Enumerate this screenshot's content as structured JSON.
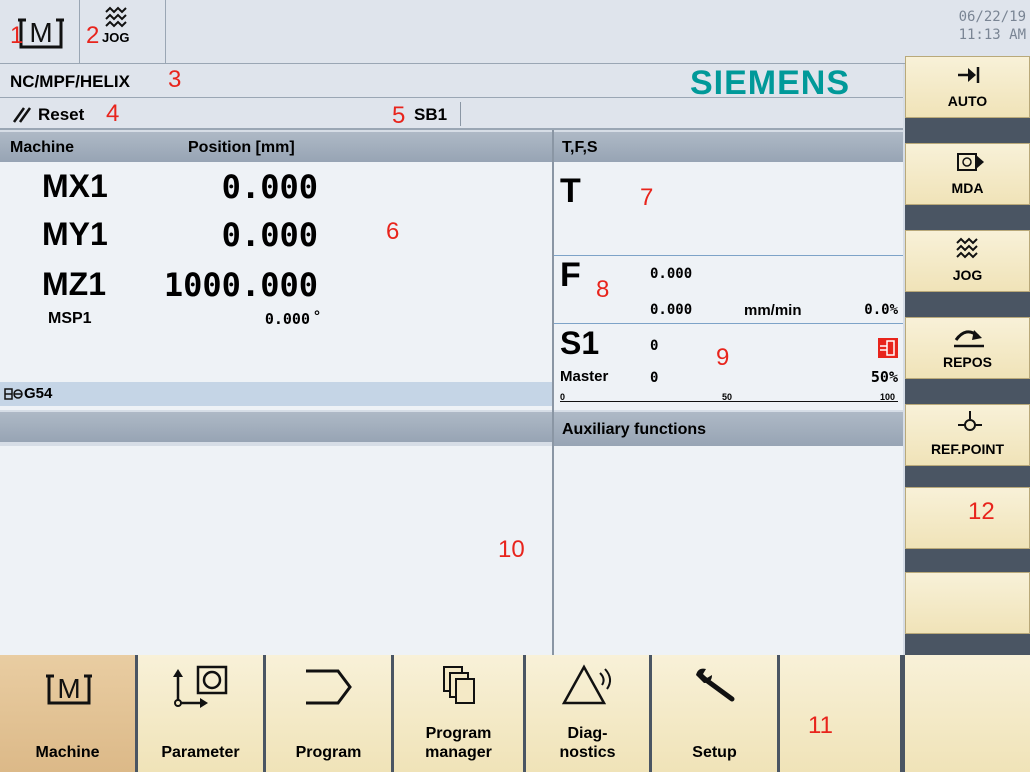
{
  "topbar": {
    "date": "06/22/19",
    "time": "11:13 AM",
    "jog_label": "JOG"
  },
  "program": {
    "path": "NC/MPF/HELIX",
    "brand": "SIEMENS"
  },
  "status": {
    "reset_label": "Reset",
    "block": "SB1"
  },
  "machine_panel": {
    "col_machine": "Machine",
    "col_position": "Position [mm]",
    "axes": [
      {
        "name": "MX1",
        "value": "0.000"
      },
      {
        "name": "MY1",
        "value": "0.000"
      },
      {
        "name": "MZ1",
        "value": "1000.000"
      }
    ],
    "spindle": {
      "name": "MSP1",
      "value": "0.000",
      "unit": "°"
    },
    "work_offset": "G54"
  },
  "tfs_panel": {
    "title": "T,F,S",
    "t_label": "T",
    "f_label": "F",
    "f_value1": "0.000",
    "f_value2": "0.000",
    "f_unit": "mm/min",
    "f_percent": "0.0%",
    "s_label": "S1",
    "s_value": "0",
    "s_master": "Master",
    "s_master_value": "0",
    "s_percent": "50%",
    "scale": [
      "0",
      "50",
      "100"
    ]
  },
  "aux_panel": {
    "title": "Auxiliary functions"
  },
  "vertical_softkeys": [
    {
      "label": "AUTO"
    },
    {
      "label": "MDA"
    },
    {
      "label": "JOG"
    },
    {
      "label": "REPOS"
    },
    {
      "label": "REF.POINT"
    },
    {
      "label": ""
    },
    {
      "label": ""
    }
  ],
  "horizontal_softkeys": [
    {
      "line1": "Machine",
      "line2": ""
    },
    {
      "line1": "Parameter",
      "line2": ""
    },
    {
      "line1": "Program",
      "line2": ""
    },
    {
      "line1": "Program",
      "line2": "manager"
    },
    {
      "line1": "Diag-",
      "line2": "nostics"
    },
    {
      "line1": "Setup",
      "line2": ""
    },
    {
      "line1": "",
      "line2": ""
    },
    {
      "line1": "",
      "line2": ""
    }
  ],
  "callouts": [
    "1",
    "2",
    "3",
    "4",
    "5",
    "6",
    "7",
    "8",
    "9",
    "10",
    "11",
    "12"
  ],
  "colors": {
    "brand": "#009999",
    "callout": "#e8241c",
    "softkey": "#f4e9c6",
    "active_softkey": "#e3c395",
    "spindle_alarm": "#e8241c"
  }
}
